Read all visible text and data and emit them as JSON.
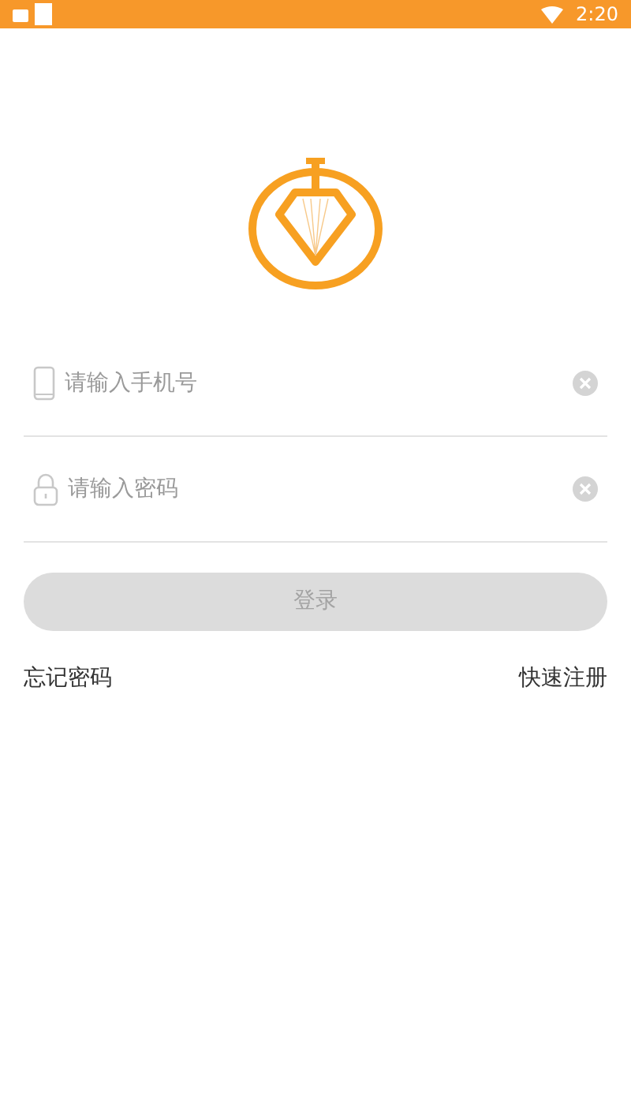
{
  "status_bar": {
    "time": "2:20"
  },
  "fields": [
    {
      "kind": "phone",
      "placeholder": "请输入手机号"
    },
    {
      "kind": "password",
      "placeholder": "请输入密码"
    }
  ],
  "login_button": {
    "label": "登录",
    "disabled": true
  },
  "links": {
    "forgot_password": "忘记密码",
    "quick_register": "快速注册"
  }
}
